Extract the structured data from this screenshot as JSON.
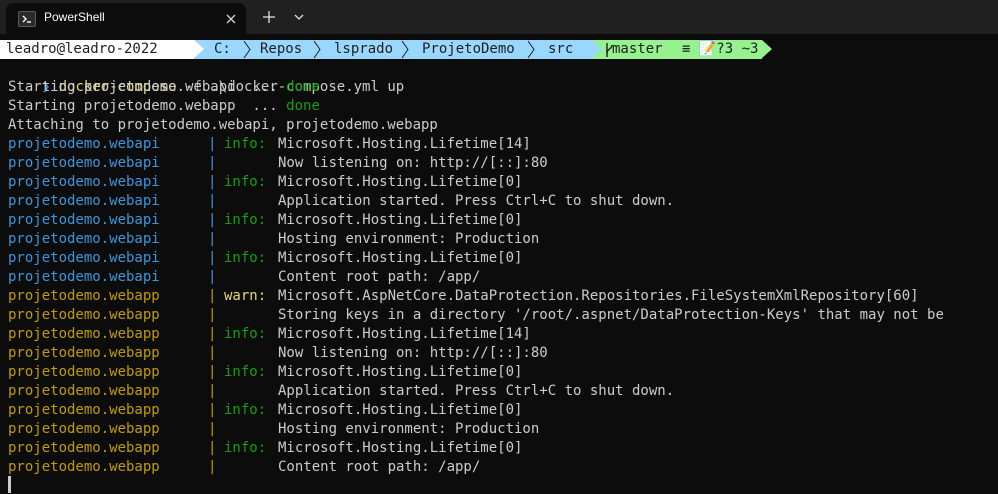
{
  "window": {
    "tab_title": "PowerShell"
  },
  "prompt": {
    "user_host": "leadro@leadro-2022",
    "path": [
      "C:",
      "Repos",
      "lsprado",
      "ProjetoDemo",
      "src"
    ],
    "branch": "master",
    "git_status": "≡ 📝?3 ~3"
  },
  "command": {
    "symbol": "❯",
    "executable": "docker-compose",
    "flag": "-f",
    "args": ".\\docker-compose.yml up"
  },
  "startup": [
    {
      "text": "Starting projetodemo.webapi  ... ",
      "status": "done"
    },
    {
      "text": "Starting projetodemo.webapp  ... ",
      "status": "done"
    }
  ],
  "attaching": "Attaching to projetodemo.webapi, projetodemo.webapp",
  "logs": [
    {
      "service": "projetodemo.webapi",
      "kind": "api",
      "level": "info:",
      "msg": "Microsoft.Hosting.Lifetime[14]"
    },
    {
      "service": "projetodemo.webapi",
      "kind": "api",
      "level": "",
      "msg": "Now listening on: http://[::]:80"
    },
    {
      "service": "projetodemo.webapi",
      "kind": "api",
      "level": "info:",
      "msg": "Microsoft.Hosting.Lifetime[0]"
    },
    {
      "service": "projetodemo.webapi",
      "kind": "api",
      "level": "",
      "msg": "Application started. Press Ctrl+C to shut down."
    },
    {
      "service": "projetodemo.webapi",
      "kind": "api",
      "level": "info:",
      "msg": "Microsoft.Hosting.Lifetime[0]"
    },
    {
      "service": "projetodemo.webapi",
      "kind": "api",
      "level": "",
      "msg": "Hosting environment: Production"
    },
    {
      "service": "projetodemo.webapi",
      "kind": "api",
      "level": "info:",
      "msg": "Microsoft.Hosting.Lifetime[0]"
    },
    {
      "service": "projetodemo.webapi",
      "kind": "api",
      "level": "",
      "msg": "Content root path: /app/"
    },
    {
      "service": "projetodemo.webapp",
      "kind": "app",
      "level": "warn:",
      "msg": "Microsoft.AspNetCore.DataProtection.Repositories.FileSystemXmlRepository[60]"
    },
    {
      "service": "projetodemo.webapp",
      "kind": "app",
      "level": "",
      "msg": "Storing keys in a directory '/root/.aspnet/DataProtection-Keys' that may not be"
    },
    {
      "service": "projetodemo.webapp",
      "kind": "app",
      "level": "info:",
      "msg": "Microsoft.Hosting.Lifetime[14]"
    },
    {
      "service": "projetodemo.webapp",
      "kind": "app",
      "level": "",
      "msg": "Now listening on: http://[::]:80"
    },
    {
      "service": "projetodemo.webapp",
      "kind": "app",
      "level": "info:",
      "msg": "Microsoft.Hosting.Lifetime[0]"
    },
    {
      "service": "projetodemo.webapp",
      "kind": "app",
      "level": "",
      "msg": "Application started. Press Ctrl+C to shut down."
    },
    {
      "service": "projetodemo.webapp",
      "kind": "app",
      "level": "info:",
      "msg": "Microsoft.Hosting.Lifetime[0]"
    },
    {
      "service": "projetodemo.webapp",
      "kind": "app",
      "level": "",
      "msg": "Hosting environment: Production"
    },
    {
      "service": "projetodemo.webapp",
      "kind": "app",
      "level": "info:",
      "msg": "Microsoft.Hosting.Lifetime[0]"
    },
    {
      "service": "projetodemo.webapp",
      "kind": "app",
      "level": "",
      "msg": "Content root path: /app/"
    }
  ],
  "pipe": "|",
  "colors": {
    "api": "#3a96dd",
    "app": "#c19c00",
    "info": "#13a10e",
    "warn": "#e6db74",
    "done": "#13a10e"
  }
}
